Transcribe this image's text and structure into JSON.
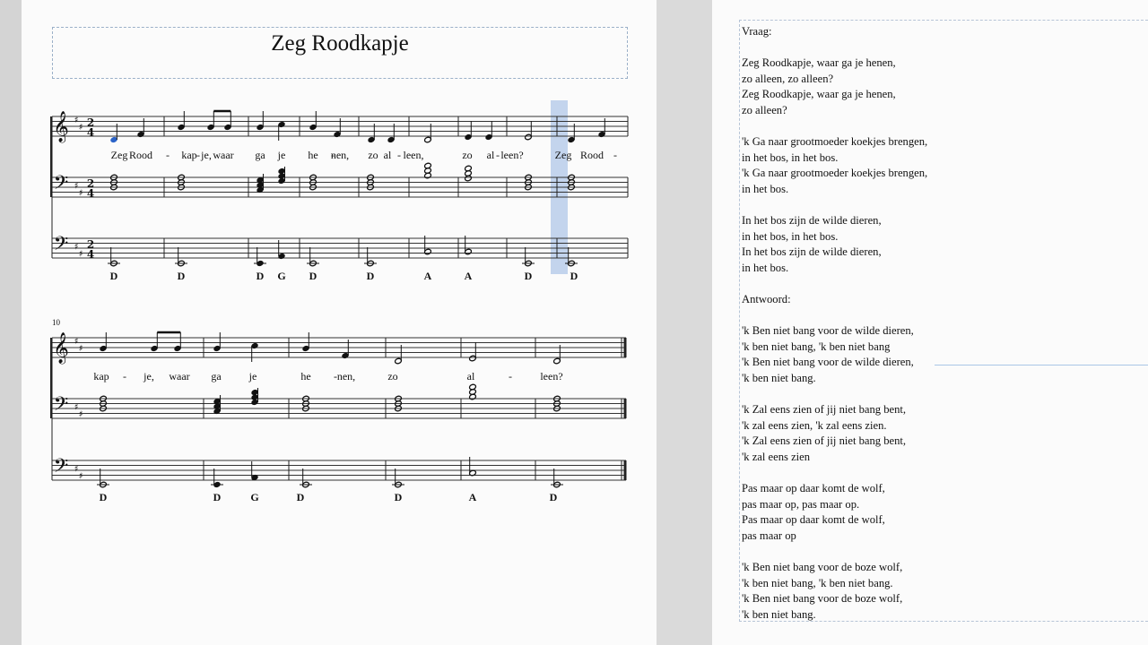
{
  "score": {
    "title": "Zeg Roodkapje",
    "measure_number_system2": "10",
    "time_signature": {
      "top": "2",
      "bottom": "4"
    },
    "system1": {
      "lyrics": [
        "Zeg",
        "Rood",
        "-",
        "kap",
        "-",
        "je,",
        "waar",
        "ga",
        "je",
        "he",
        "-",
        "nen,",
        "zo",
        "al",
        "-",
        "leen,",
        "zo",
        "al",
        "-",
        "leen?",
        "Zeg",
        "Rood",
        "-"
      ],
      "chords": [
        "D",
        "D",
        "D",
        "G",
        "D",
        "D",
        "A",
        "A",
        "D",
        "D"
      ]
    },
    "system2": {
      "lyrics": [
        "kap",
        "-",
        "je,",
        "waar",
        "ga",
        "je",
        "he",
        "-",
        "nen,",
        "zo",
        "al",
        "-",
        "leen?"
      ],
      "chords": [
        "D",
        "D",
        "G",
        "D",
        "D",
        "A",
        "D"
      ]
    }
  },
  "lyrics": [
    "Vraag:",
    "",
    "Zeg Roodkapje, waar ga je henen,",
    "zo alleen, zo alleen?",
    "Zeg Roodkapje, waar ga je henen,",
    "zo alleen?",
    "",
    "'k Ga naar grootmoeder koekjes brengen,",
    "in het bos, in het bos.",
    "'k Ga naar grootmoeder koekjes brengen,",
    "in het bos.",
    "",
    "In het bos zijn de wilde dieren,",
    "in het bos, in het bos.",
    "In het bos zijn de wilde dieren,",
    "in het bos.",
    "",
    "Antwoord:",
    "",
    "'k Ben niet bang voor de wilde dieren,",
    "'k ben niet bang, 'k ben niet bang",
    "'k Ben niet bang voor de wilde dieren,",
    "'k ben niet bang.",
    "",
    "'k Zal eens zien of jij niet bang bent,",
    "'k zal eens zien, 'k zal eens zien.",
    "'k Zal eens zien of jij niet bang bent,",
    "'k zal eens zien",
    "",
    "Pas maar op daar komt de wolf,",
    "pas maar op, pas maar op.",
    "Pas maar op daar komt de wolf,",
    "pas maar op",
    "",
    "'k Ben niet bang voor de boze wolf,",
    "'k ben niet bang, 'k ben niet bang.",
    "'k Ben niet bang voor de boze wolf,",
    "'k ben niet bang."
  ],
  "colors": {
    "selected_note": "#2a63c8",
    "playback_cursor": "#b9cdea",
    "frame_border": "#9bb0c8",
    "ink": "#111111"
  }
}
